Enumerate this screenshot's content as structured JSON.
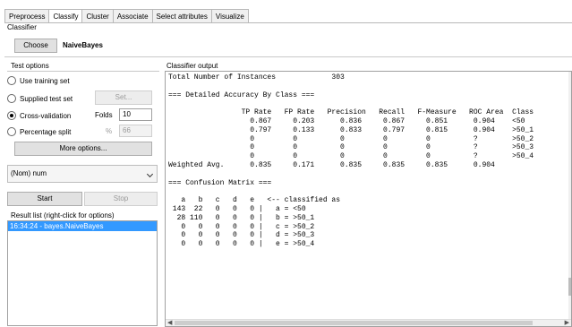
{
  "tabs": [
    "Preprocess",
    "Classify",
    "Cluster",
    "Associate",
    "Select attributes",
    "Visualize"
  ],
  "classifier": {
    "group_label": "Classifier",
    "choose_label": "Choose",
    "name": "NaiveBayes"
  },
  "test_options": {
    "group_label": "Test options",
    "use_training_set": "Use training set",
    "supplied_test_set": "Supplied test set",
    "set_button": "Set...",
    "cross_validation": "Cross-validation",
    "folds_label": "Folds",
    "folds_value": "10",
    "percentage_split": "Percentage split",
    "percent_symbol": "%",
    "percent_value": "66",
    "more_options": "More options...",
    "selected": "cross_validation"
  },
  "class_attribute": {
    "value": "(Nom) num"
  },
  "run": {
    "start_label": "Start",
    "stop_label": "Stop"
  },
  "result_list": {
    "label": "Result list (right-click for options)",
    "items": [
      "16:34:24 - bayes.NaiveBayes"
    ]
  },
  "output": {
    "label": "Classifier output",
    "text": "Total Number of Instances             303\n\n=== Detailed Accuracy By Class ===\n\n                 TP Rate   FP Rate   Precision   Recall   F-Measure   ROC Area  Class\n                   0.867     0.203      0.836     0.867     0.851      0.904    <50\n                   0.797     0.133      0.833     0.797     0.815      0.904    >50_1\n                   0         0          0         0         0          ?        >50_2\n                   0         0          0         0         0          ?        >50_3\n                   0         0          0         0         0          ?        >50_4\nWeighted Avg.      0.835     0.171      0.835     0.835     0.835      0.904\n\n=== Confusion Matrix ===\n\n   a   b   c   d   e   <-- classified as\n 143  22   0   0   0 |   a = <50\n  28 110   0   0   0 |   b = >50_1\n   0   0   0   0   0 |   c = >50_2\n   0   0   0   0   0 |   d = >50_3\n   0   0   0   0   0 |   e = >50_4"
  },
  "colors": {
    "selection": "#3399ff",
    "button_face": "#e1e1e1"
  }
}
